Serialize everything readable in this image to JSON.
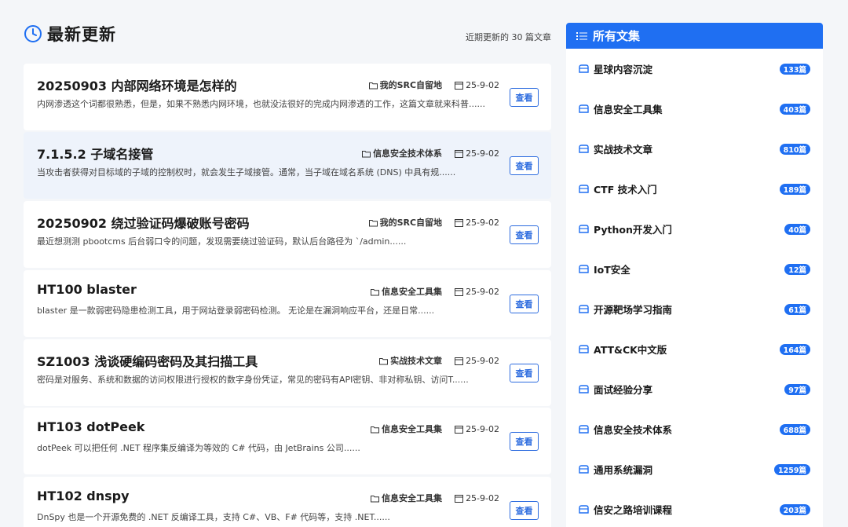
{
  "header": {
    "title": "最新更新",
    "recent_note": "近期更新的 30 篇文章"
  },
  "articles": [
    {
      "title": "20250903 内部网络环境是怎样的",
      "category": "我的SRC自留地",
      "date": "25-9-02",
      "desc": "内网渗透这个词都很熟悉，但是，如果不熟悉内网环境，也就没法很好的完成内网渗透的工作，这篇文章就来科普......",
      "view": "查看"
    },
    {
      "title": "7.1.5.2 子域名接管",
      "category": "信息安全技术体系",
      "date": "25-9-02",
      "desc": "当攻击者获得对目标域的子域的控制权时，就会发生子域接管。通常，当子域在域名系统 (DNS) 中具有规......",
      "view": "查看"
    },
    {
      "title": "20250902 绕过验证码爆破账号密码",
      "category": "我的SRC自留地",
      "date": "25-9-02",
      "desc": "最近想测测 pbootcms 后台弱口令的问题，发现需要绕过验证码，默认后台路径为 `/admin......",
      "view": "查看"
    },
    {
      "title": "HT100 blaster",
      "category": "信息安全工具集",
      "date": "25-9-02",
      "desc": "blaster 是一款弱密码隐患检测工具，用于网站登录弱密码检测。 无论是在漏洞响应平台，还是日常......",
      "view": "查看"
    },
    {
      "title": "SZ1003 浅谈硬编码密码及其扫描工具",
      "category": "实战技术文章",
      "date": "25-9-02",
      "desc": "密码是对服务、系统和数据的访问权限进行授权的数字身份凭证，常见的密码有API密钥、非对称私钥、访问T......",
      "view": "查看"
    },
    {
      "title": "HT103 dotPeek",
      "category": "信息安全工具集",
      "date": "25-9-02",
      "desc": "dotPeek 可以把任何 .NET 程序集反编译为等效的 C# 代码，由 JetBrains 公司......",
      "view": "查看"
    },
    {
      "title": "HT102 dnspy",
      "category": "信息安全工具集",
      "date": "25-9-02",
      "desc": "DnSpy 也是一个开源免费的 .NET 反编译工具，支持 C#、VB、F# 代码等，支持 .NET......",
      "view": "查看"
    }
  ],
  "sidebar": {
    "title": "所有文集",
    "items": [
      {
        "label": "星球内容沉淀",
        "count": "133篇"
      },
      {
        "label": "信息安全工具集",
        "count": "403篇"
      },
      {
        "label": "实战技术文章",
        "count": "810篇"
      },
      {
        "label": "CTF 技术入门",
        "count": "189篇"
      },
      {
        "label": "Python开发入门",
        "count": "40篇"
      },
      {
        "label": "IoT安全",
        "count": "12篇"
      },
      {
        "label": "开源靶场学习指南",
        "count": "61篇"
      },
      {
        "label": "ATT&CK中文版",
        "count": "164篇"
      },
      {
        "label": "面试经验分享",
        "count": "97篇"
      },
      {
        "label": "信息安全技术体系",
        "count": "688篇"
      },
      {
        "label": "通用系统漏洞",
        "count": "1259篇"
      },
      {
        "label": "信安之路培训课程",
        "count": "203篇"
      }
    ]
  },
  "colors": {
    "accent": "#1f6ff2",
    "button": "#2d6cdf",
    "highlight_row": "#eef3fb"
  }
}
